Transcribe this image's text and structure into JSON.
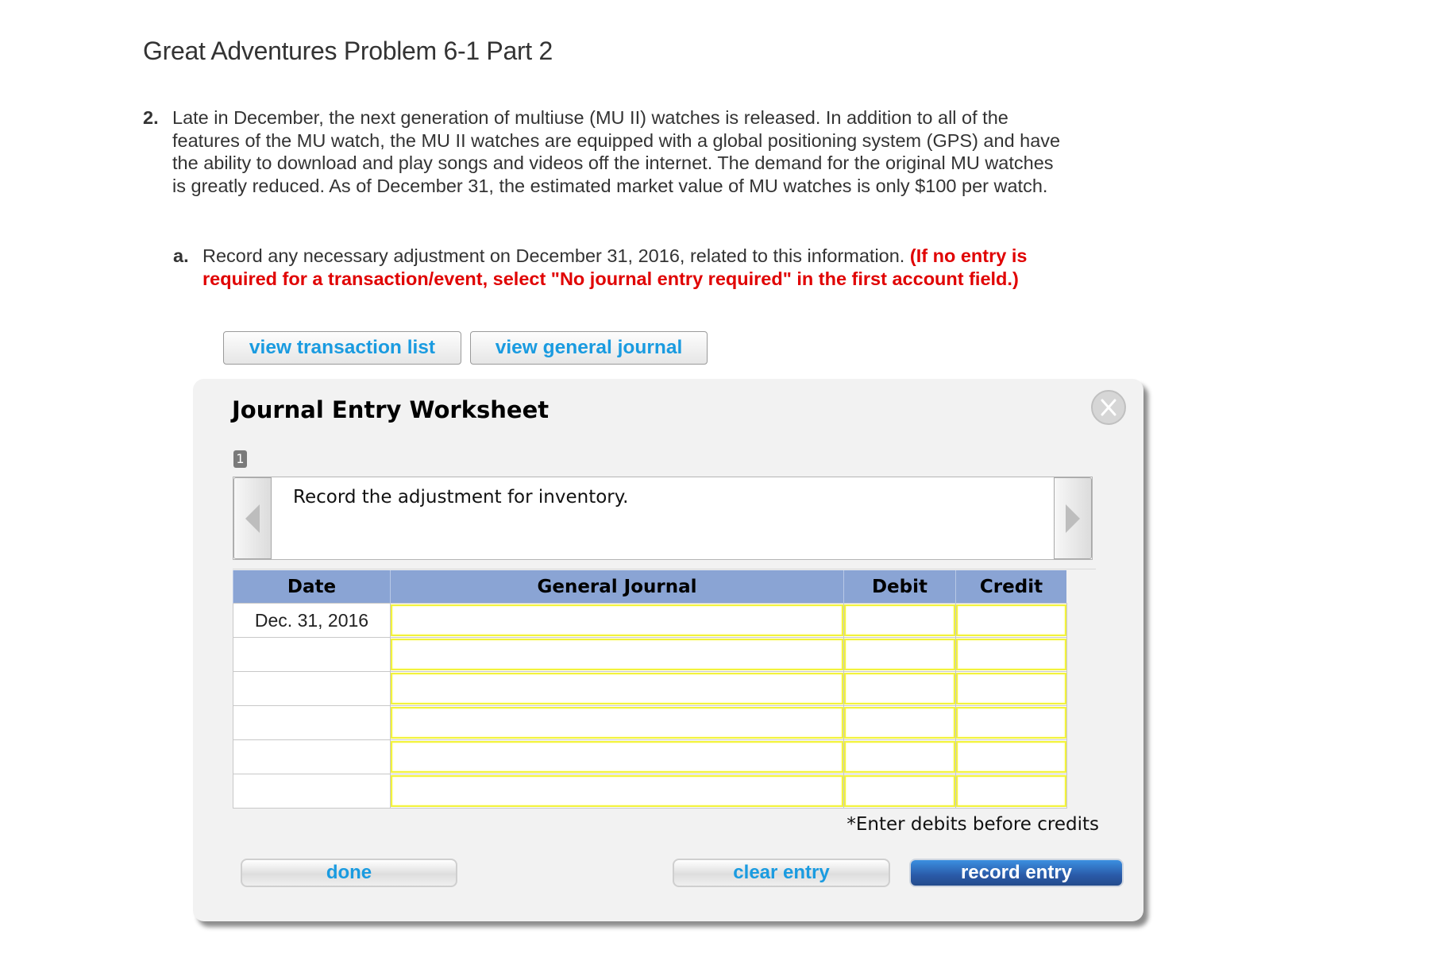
{
  "page": {
    "title": "Great Adventures Problem 6-1 Part 2"
  },
  "question": {
    "number": "2.",
    "text": "Late in December, the next generation of multiuse (MU II) watches is released. In addition to all of the features of the MU watch, the MU II watches are equipped with a global positioning system (GPS) and have the ability to download and play songs and videos off the internet. The demand for the original MU watches is greatly reduced. As of December 31, the estimated market value of MU watches is only $100 per watch."
  },
  "subquestion": {
    "letter": "a.",
    "text": "Record any necessary adjustment on December 31, 2016, related to this information.",
    "hint": "(If no entry is required for a transaction/event, select \"No journal entry required\" in the first account field.)"
  },
  "toolbar": {
    "view_transaction_list": "view transaction list",
    "view_general_journal": "view general journal"
  },
  "worksheet": {
    "title": "Journal Entry Worksheet",
    "close_label": "X",
    "page_badge": "1",
    "prompt": "Record the adjustment for inventory.",
    "columns": [
      "Date",
      "General Journal",
      "Debit",
      "Credit"
    ],
    "rows": [
      {
        "date": "Dec. 31, 2016",
        "account": "",
        "debit": "",
        "credit": ""
      },
      {
        "date": "",
        "account": "",
        "debit": "",
        "credit": ""
      },
      {
        "date": "",
        "account": "",
        "debit": "",
        "credit": ""
      },
      {
        "date": "",
        "account": "",
        "debit": "",
        "credit": ""
      },
      {
        "date": "",
        "account": "",
        "debit": "",
        "credit": ""
      },
      {
        "date": "",
        "account": "",
        "debit": "",
        "credit": ""
      }
    ],
    "note": "*Enter debits before credits",
    "buttons": {
      "done": "done",
      "clear_entry": "clear entry",
      "record_entry": "record entry"
    }
  },
  "colors": {
    "link_blue": "#1a9be0",
    "hint_red": "#e00000",
    "header_blue": "#8aa4d4",
    "input_highlight": "#f2f23c",
    "record_button": "#2a5aa8"
  }
}
